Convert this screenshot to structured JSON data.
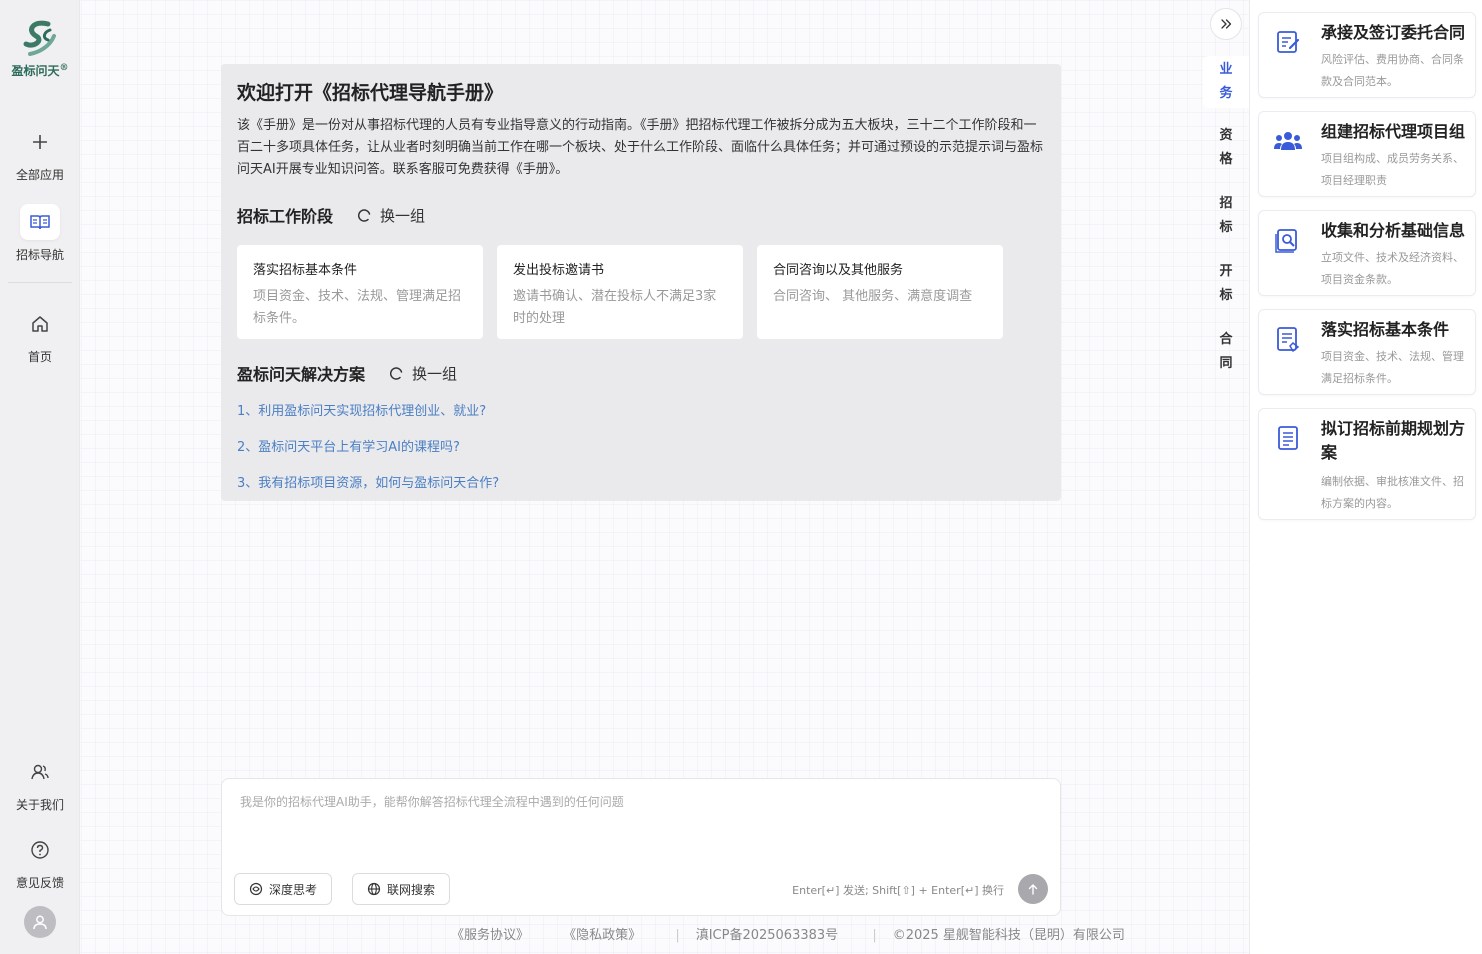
{
  "brand": {
    "name": "盈标问天",
    "mark": "®"
  },
  "sidebar": {
    "top_items": [
      {
        "label": "全部应用",
        "icon": "plus-icon"
      },
      {
        "label": "招标导航",
        "icon": "book-icon"
      },
      {
        "label": "首页",
        "icon": "home-icon"
      }
    ],
    "bottom_items": [
      {
        "label": "关于我们",
        "icon": "people-icon"
      },
      {
        "label": "意见反馈",
        "icon": "help-icon"
      }
    ],
    "avatar_icon": "user-avatar-icon"
  },
  "welcome": {
    "title": "欢迎打开《招标代理导航手册》",
    "description": "该《手册》是一份对从事招标代理的人员有专业指导意义的行动指南。《手册》把招标代理工作被拆分成为五大板块，三十二个工作阶段和一百二十多项具体任务，让从业者时刻明确当前工作在哪一个板块、处于什么工作阶段、面临什么具体任务；并可通过预设的示范提示词与盈标问天AI开展专业知识问答。联系客服可免费获得《手册》。",
    "stages_title": "招标工作阶段",
    "refresh_label": "换一组",
    "stages": [
      {
        "title": "落实招标基本条件",
        "desc": "项目资金、技术、法规、管理满足招标条件。"
      },
      {
        "title": "发出投标邀请书",
        "desc": "邀请书确认、潜在投标人不满足3家时的处理"
      },
      {
        "title": "合同咨询以及其他服务",
        "desc": "合同咨询、 其他服务、满意度调查"
      }
    ],
    "solutions_title": "盈标问天解决方案",
    "solutions_refresh_label": "换一组",
    "questions": [
      "1、利用盈标问天实现招标代理创业、就业?",
      "2、盈标问天平台上有学习AI的课程吗?",
      "3、我有招标项目资源，如何与盈标问天合作?"
    ]
  },
  "input": {
    "placeholder": "我是你的招标代理AI助手，能帮你解答招标代理全流程中遇到的任何问题",
    "value": "",
    "deep_think_label": "深度思考",
    "web_search_label": "联网搜索",
    "hint": "Enter[↵] 发送; Shift[⇧] + Enter[↵] 换行"
  },
  "footer": {
    "service": "《服务协议》",
    "privacy": "《隐私政策》",
    "icp": "滇ICP备2025063383号",
    "copyright": "©2025 星舰智能科技（昆明）有限公司"
  },
  "vtabs": [
    {
      "l1": "业",
      "l2": "务",
      "active": true
    },
    {
      "l1": "资",
      "l2": "格",
      "active": false
    },
    {
      "l1": "招",
      "l2": "标",
      "active": false
    },
    {
      "l1": "开",
      "l2": "标",
      "active": false
    },
    {
      "l1": "合",
      "l2": "同",
      "active": false
    }
  ],
  "panel_cards": [
    {
      "title": "承接及签订委托合同",
      "desc": "风险评估、费用协商、合同条款及合同范本。",
      "icon": "contract-edit-icon"
    },
    {
      "title": "组建招标代理项目组",
      "desc": "项目组构成、成员劳务关系、项目经理职责",
      "icon": "team-icon"
    },
    {
      "title": "收集和分析基础信息",
      "desc": "立项文件、技术及经济资料、项目资金条款。",
      "icon": "document-search-icon"
    },
    {
      "title": "落实招标基本条件",
      "desc": "项目资金、技术、法规、管理满足招标条件。",
      "icon": "checklist-icon"
    },
    {
      "title": "拟订招标前期规划方案",
      "desc": "编制依据、审批核准文件、招标方案的内容。",
      "icon": "plan-document-icon"
    }
  ],
  "colors": {
    "accent": "#3a5bd9",
    "link": "#4a7fc4",
    "brand_green": "#2e6b5a"
  }
}
